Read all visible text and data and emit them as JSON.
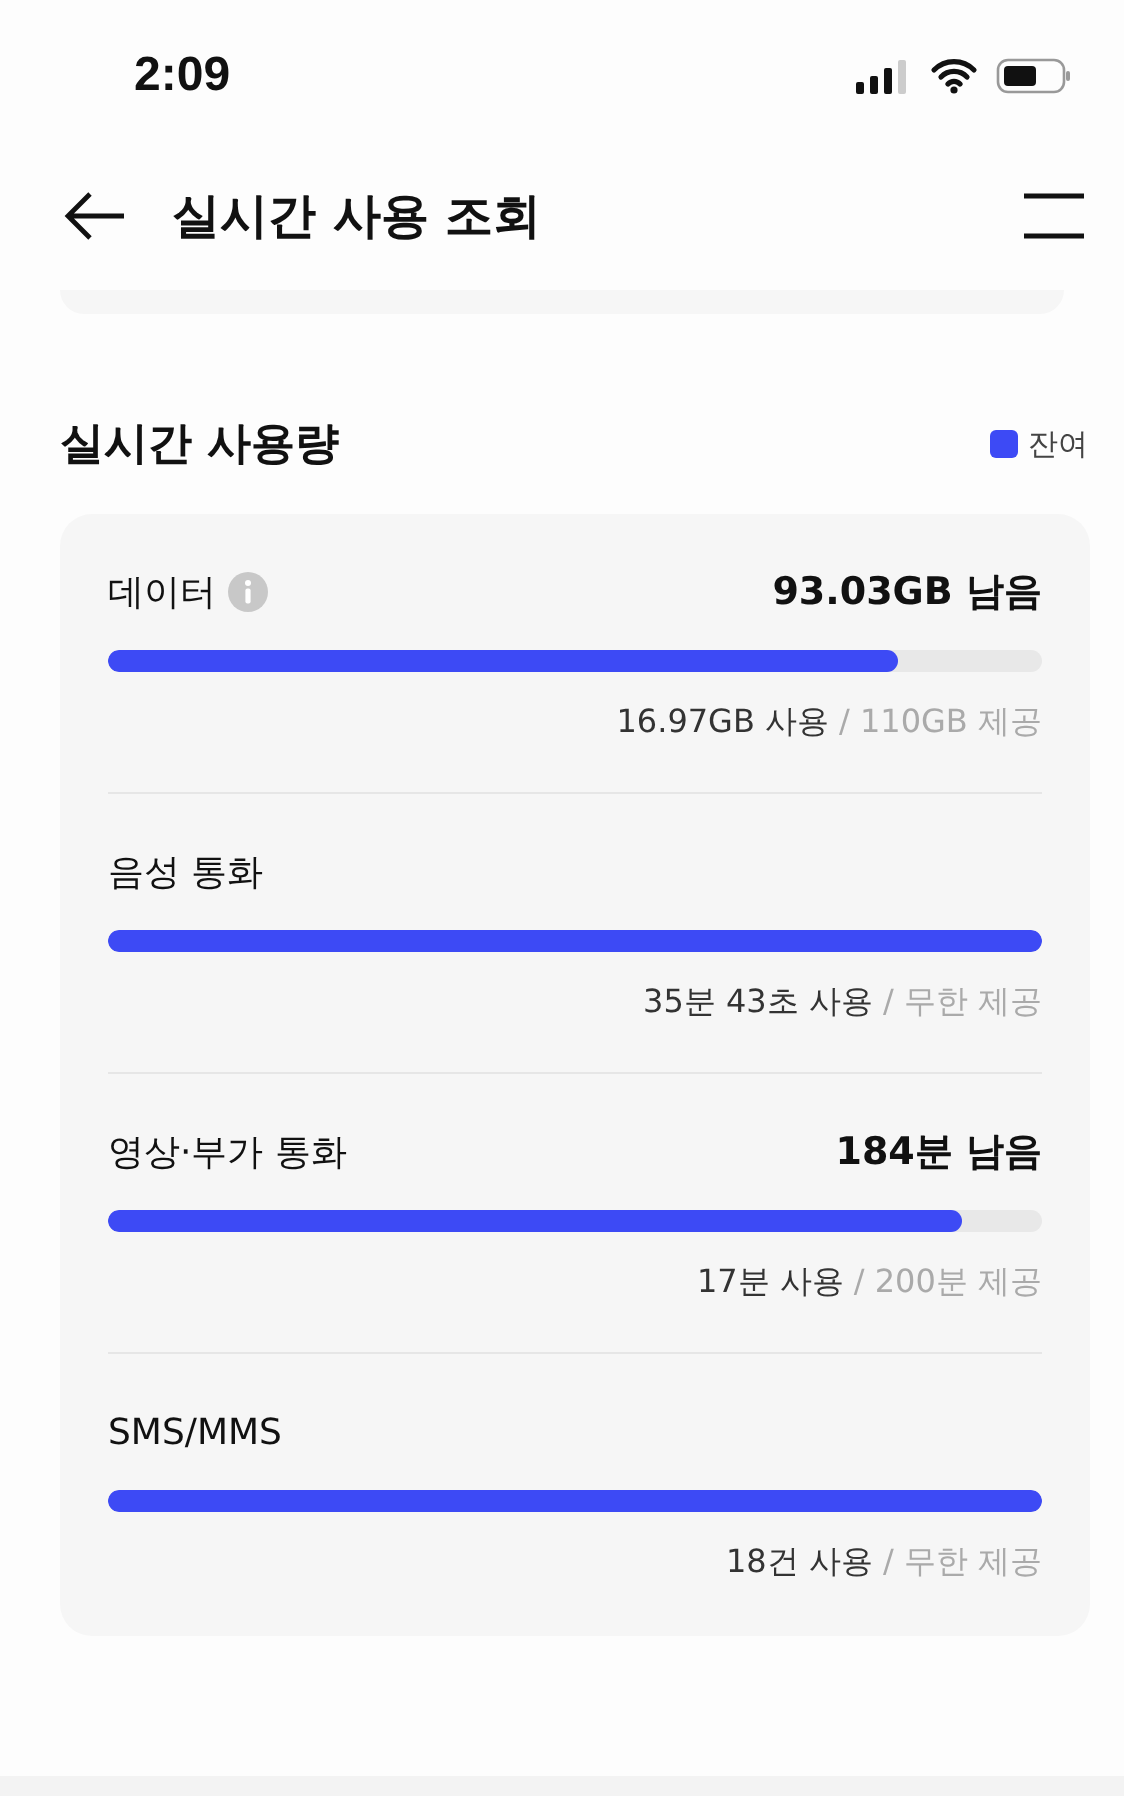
{
  "status_bar": {
    "time": "2:09"
  },
  "header": {
    "title": "실시간 사용 조회"
  },
  "section": {
    "title": "실시간 사용량",
    "legend": {
      "label": "잔여",
      "color": "#3d4af5"
    }
  },
  "usage": [
    {
      "name": "데이터",
      "info": true,
      "remaining": "93.03GB 남음",
      "level": 0.846,
      "used": "16.97GB 사용",
      "provided": "/ 110GB 제공"
    },
    {
      "name": "음성 통화",
      "info": false,
      "level": 1,
      "used": "35분 43초 사용",
      "provided": "/ 무한 제공"
    },
    {
      "name": "영상·부가 통화",
      "info": false,
      "remaining": "184분 남음",
      "level": 0.915,
      "used": "17분 사용",
      "provided": "/ 200분 제공"
    },
    {
      "name": "SMS/MMS",
      "info": false,
      "level": 1,
      "used": "18건 사용",
      "provided": "/ 무한 제공"
    }
  ]
}
